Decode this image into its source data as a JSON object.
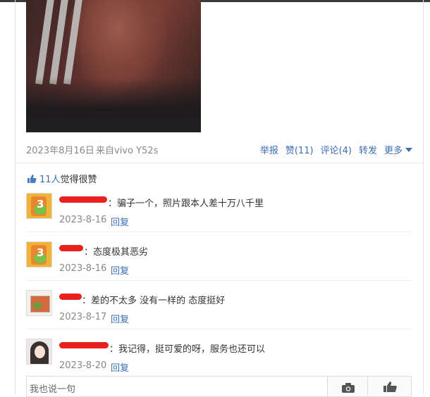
{
  "post": {
    "date": "2023年8月16日",
    "source": "来自vivo Y52s",
    "actions": {
      "report": "举报",
      "like": "赞(11)",
      "comment": "评论(4)",
      "share": "转发",
      "more": "更多"
    }
  },
  "likes_summary": {
    "count": "11人",
    "text": "觉得很赞"
  },
  "comments": [
    {
      "text": "：骗子一个，照片跟本人差十万八千里",
      "date": "2023-8-16",
      "reply": "回复",
      "avatar": "cartoon-avatar"
    },
    {
      "text": "：态度极其恶劣",
      "date": "2023-8-16",
      "reply": "回复",
      "avatar": "cartoon-avatar"
    },
    {
      "text": "：差的不太多 没有一样的 态度挺好",
      "date": "2023-8-17",
      "reply": "回复",
      "avatar": "book-avatar"
    },
    {
      "text": "：我记得，挺可爱的呀，服务也还可以",
      "date": "2023-8-20",
      "reply": "回复",
      "avatar": "girl-avatar"
    }
  ],
  "composer": {
    "placeholder": "我也说一句",
    "camera_icon": "camera-icon",
    "like_icon": "thumbs-up-icon"
  },
  "colors": {
    "link": "#3b6fb6",
    "redaction": "#e8211e"
  }
}
